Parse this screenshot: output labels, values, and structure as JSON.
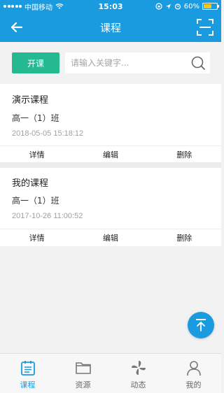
{
  "status_bar": {
    "carrier": "中国移动",
    "time": "15:03",
    "battery": "60%",
    "battery_level": 0.6
  },
  "header": {
    "title": "课程"
  },
  "toolbar": {
    "start_label": "开课",
    "search_placeholder": "请输入关键字..."
  },
  "courses": [
    {
      "name": "演示课程",
      "class_name": "高一（1）班",
      "datetime": "2018-05-05 15:18:12",
      "actions": [
        "详情",
        "编辑",
        "删除"
      ]
    },
    {
      "name": "我的课程",
      "class_name": "高一（1）班",
      "datetime": "2017-10-26 11:00:52",
      "actions": [
        "详情",
        "编辑",
        "删除"
      ]
    }
  ],
  "tabs": [
    {
      "label": "课程",
      "icon": "course-icon",
      "active": true
    },
    {
      "label": "资源",
      "icon": "folder-icon",
      "active": false
    },
    {
      "label": "动态",
      "icon": "pinwheel-icon",
      "active": false
    },
    {
      "label": "我的",
      "icon": "user-icon",
      "active": false
    }
  ],
  "colors": {
    "primary": "#1a9be0",
    "accent_green": "#25b991",
    "background": "#f2f2f2"
  }
}
